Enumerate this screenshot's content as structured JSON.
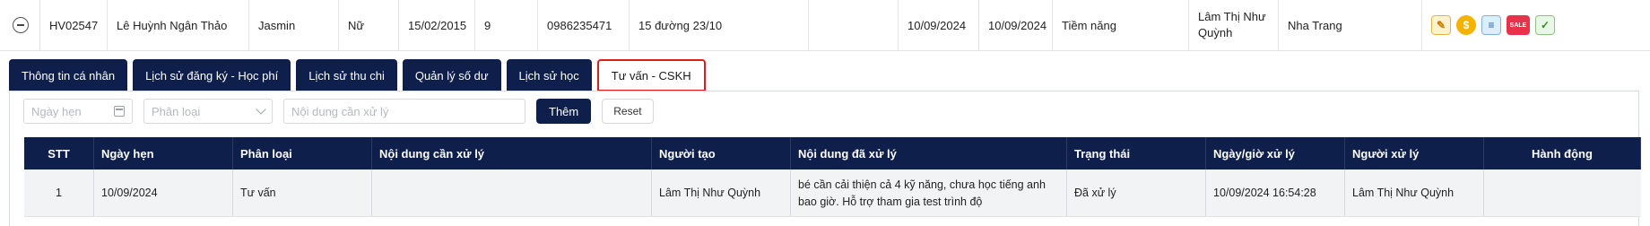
{
  "record": {
    "code": "HV02547",
    "name": "Lê Huỳnh Ngân Thảo",
    "english_name": "Jasmin",
    "gender": "Nữ",
    "dob": "15/02/2015",
    "grade": "9",
    "phone": "0986235471",
    "address": "15 đường 23/10",
    "extra": "",
    "date1": "10/09/2024",
    "date2": "10/09/2024",
    "status": "Tiềm năng",
    "counselor_line1": "Lâm Thị Như",
    "counselor_line2": "Quỳnh",
    "branch": "Nha Trang",
    "action_icons": [
      "edit-icon",
      "coin-icon",
      "document-icon",
      "sale-tag-icon",
      "graduation-icon"
    ],
    "sale_label": "SALE"
  },
  "tabs": [
    {
      "label": "Thông tin cá nhân",
      "active": false
    },
    {
      "label": "Lịch sử đăng ký - Học phí",
      "active": false
    },
    {
      "label": "Lịch sử thu chi",
      "active": false
    },
    {
      "label": "Quản lý số dư",
      "active": false
    },
    {
      "label": "Lịch sử học",
      "active": false
    },
    {
      "label": "Tư vấn - CSKH",
      "active": true
    }
  ],
  "filters": {
    "date_placeholder": "Ngày hẹn",
    "type_placeholder": "Phân loại",
    "content_placeholder": "Nội dung cần xử lý",
    "add_label": "Thêm",
    "reset_label": "Reset"
  },
  "table": {
    "headers": [
      "STT",
      "Ngày hẹn",
      "Phân loại",
      "Nội dung cần xử lý",
      "Người tạo",
      "Nội dung đã xử lý",
      "Trạng thái",
      "Ngày/giờ xử lý",
      "Người xử lý",
      "Hành động"
    ],
    "rows": [
      {
        "stt": "1",
        "date": "10/09/2024",
        "type": "Tư vấn",
        "content": "",
        "creator": "Lâm Thị Như Quỳnh",
        "done_line1": "bé cần cải thiện cả 4 kỹ năng, chưa học tiếng anh",
        "done_line2": "bao giờ. Hỗ trợ tham gia test trình độ",
        "status": "Đã xử lý",
        "time": "10/09/2024 16:54:28",
        "handler": "Lâm Thị Như Quỳnh",
        "action": ""
      }
    ]
  },
  "colors": {
    "navy": "#0f1f4b",
    "active_tab_border": "#e01d1d",
    "row_bg": "#f2f3f5"
  }
}
